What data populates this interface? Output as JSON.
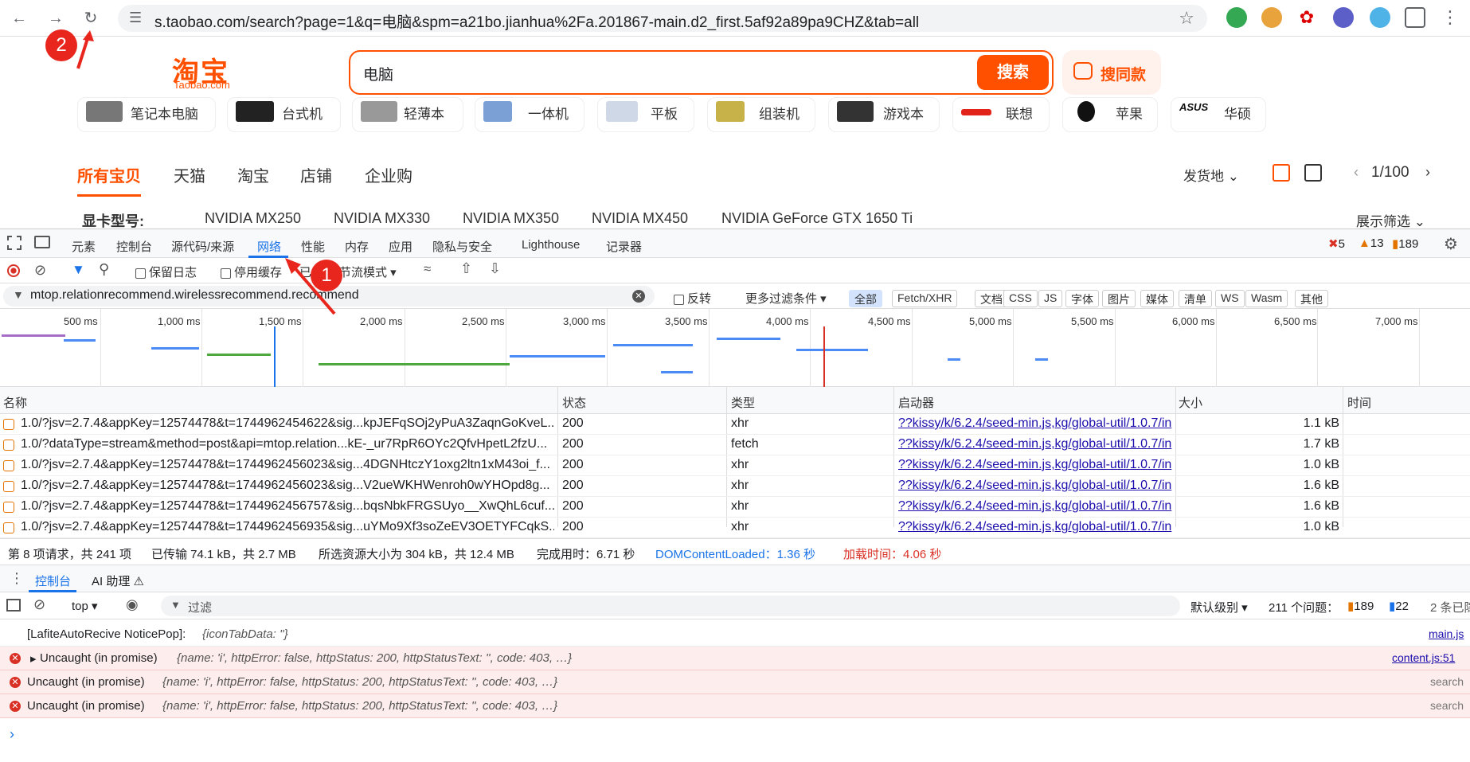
{
  "browser": {
    "url": "s.taobao.com/search?page=1&q=电脑&spm=a21bo.jianhua%2Fa.201867-main.d2_first.5af92a89pa9CHZ&tab=all",
    "back_icon": "arrow-left-icon",
    "forward_icon": "arrow-right-icon",
    "reload_icon": "reload-icon"
  },
  "annotations": {
    "step1": "1",
    "step2": "2"
  },
  "page": {
    "logo_cn": "淘宝",
    "logo_en": "Taobao.com",
    "search_value": "电脑",
    "search_button": "搜索",
    "same_button": "搜同款",
    "categories": [
      "笔记本电脑",
      "台式机",
      "轻薄本",
      "一体机",
      "平板",
      "组装机",
      "游戏本",
      "联想",
      "苹果",
      "华硕"
    ],
    "tabs": [
      "所有宝贝",
      "天猫",
      "淘宝",
      "店铺",
      "企业购"
    ],
    "ship_from": "发货地",
    "pager": "1/100",
    "filter_label": "显卡型号:",
    "filter_options": [
      "NVIDIA MX250",
      "NVIDIA MX330",
      "NVIDIA MX350",
      "NVIDIA MX450",
      "NVIDIA GeForce GTX 1650 Ti"
    ],
    "show_filter": "展示筛选"
  },
  "devtools": {
    "tabs": [
      "元素",
      "控制台",
      "源代码/来源",
      "网络",
      "性能",
      "内存",
      "应用",
      "隐私与安全",
      "Lighthouse",
      "记录器"
    ],
    "errors": "5",
    "warnings": "13",
    "issues": "189",
    "preserve_log": "保留日志",
    "disable_cache": "停用缓存",
    "throttle_mode_a": "已",
    "throttle_mode_b": "节流模式",
    "filter_text": "mtop.relationrecommend.wirelessrecommend.recommend",
    "invert": "反转",
    "more_filters": "更多过滤条件",
    "type_chips": [
      "全部",
      "Fetch/XHR",
      "文档",
      "CSS",
      "JS",
      "字体",
      "图片",
      "媒体",
      "清单",
      "WS",
      "Wasm",
      "其他"
    ],
    "timeline_labels": [
      "500 ms",
      "1,000 ms",
      "1,500 ms",
      "2,000 ms",
      "2,500 ms",
      "3,000 ms",
      "3,500 ms",
      "4,000 ms",
      "4,500 ms",
      "5,000 ms",
      "5,500 ms",
      "6,000 ms",
      "6,500 ms",
      "7,000 ms"
    ],
    "columns": [
      "名称",
      "状态",
      "类型",
      "启动器",
      "大小",
      "时间"
    ],
    "rows": [
      {
        "name": "1.0/?jsv=2.7.4&appKey=12574478&t=1744962454622&sig...kpJEFqSOj2yPuA3ZaqnGoKveL...",
        "status": "200",
        "type": "xhr",
        "initiator": "??kissy/k/6.2.4/seed-min.js,kg/global-util/1.0.7/in",
        "size": "1.1 kB"
      },
      {
        "name": "1.0/?dataType=stream&method=post&api=mtop.relation...kE-_ur7RpR6OYc2QfvHpetL2fzU...",
        "status": "200",
        "type": "fetch",
        "initiator": "??kissy/k/6.2.4/seed-min.js,kg/global-util/1.0.7/in",
        "size": "1.7 kB"
      },
      {
        "name": "1.0/?jsv=2.7.4&appKey=12574478&t=1744962456023&sig...4DGNHtczY1oxg2ltn1xM43oi_f...",
        "status": "200",
        "type": "xhr",
        "initiator": "??kissy/k/6.2.4/seed-min.js,kg/global-util/1.0.7/in",
        "size": "1.0 kB"
      },
      {
        "name": "1.0/?jsv=2.7.4&appKey=12574478&t=1744962456023&sig...V2ueWKHWenroh0wYHOpd8g...",
        "status": "200",
        "type": "xhr",
        "initiator": "??kissy/k/6.2.4/seed-min.js,kg/global-util/1.0.7/in",
        "size": "1.6 kB"
      },
      {
        "name": "1.0/?jsv=2.7.4&appKey=12574478&t=1744962456757&sig...bqsNbkFRGSUyo__XwQhL6cuf...",
        "status": "200",
        "type": "xhr",
        "initiator": "??kissy/k/6.2.4/seed-min.js,kg/global-util/1.0.7/in",
        "size": "1.6 kB"
      },
      {
        "name": "1.0/?jsv=2.7.4&appKey=12574478&t=1744962456935&sig...uYMo9Xf3soZeEV3OETYFCqkS...",
        "status": "200",
        "type": "xhr",
        "initiator": "??kissy/k/6.2.4/seed-min.js,kg/global-util/1.0.7/in",
        "size": "1.0 kB"
      }
    ],
    "summary": {
      "requests": "第 8 项请求，共 241 项",
      "transferred": "已传输 74.1 kB，共 2.7 MB",
      "resources": "所选资源大小为 304 kB，共 12.4 MB",
      "finish": "完成用时：6.71 秒",
      "dcl": "DOMContentLoaded：1.36 秒",
      "load": "加载时间：4.06 秒"
    },
    "drawer_tabs": [
      "控制台",
      "AI 助理 ⚠"
    ],
    "context": "top",
    "filter_placeholder": "过滤",
    "levels": "默认级别",
    "issues_text": "211 个问题：",
    "issue_count_a": "189",
    "issue_count_b": "22",
    "hidden": "2 条已隐",
    "console_lines": [
      {
        "msg": "[LafiteAutoRecive NoticePop]:",
        "detail": "{iconTabData: ''}",
        "source": "main.js"
      },
      {
        "msg": "Uncaught (in promise)",
        "detail": "{name: 'i', httpError: false, httpStatus: 200, httpStatusText: '', code: 403, …}",
        "source": "content.js:51"
      },
      {
        "msg": "Uncaught (in promise)",
        "detail": "{name: 'i', httpError: false, httpStatus: 200, httpStatusText: '', code: 403, …}",
        "source": "search"
      },
      {
        "msg": "Uncaught (in promise)",
        "detail": "{name: 'i', httpError: false, httpStatus: 200, httpStatusText: '', code: 403, …}",
        "source": "search"
      }
    ],
    "prompt": "›"
  },
  "colors": {
    "brand": "#ff5000",
    "annotation": "#e8261e",
    "error_bg": "#fdeded",
    "devtools_accent": "#1a73e8"
  }
}
